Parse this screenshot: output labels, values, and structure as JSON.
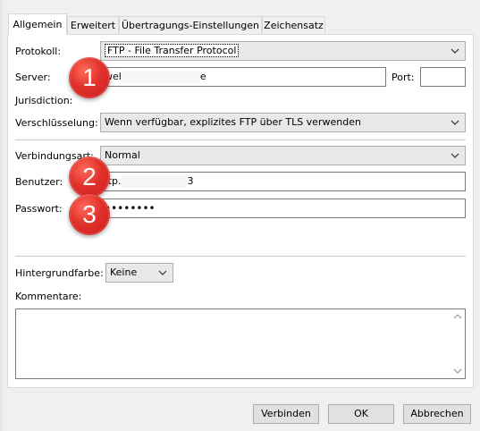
{
  "tabs": [
    {
      "label": "Allgemein",
      "active": true
    },
    {
      "label": "Erweitert",
      "active": false
    },
    {
      "label": "Übertragungs-Einstellungen",
      "active": false
    },
    {
      "label": "Zeichensatz",
      "active": false
    }
  ],
  "form": {
    "protokoll_label": "Protokoll:",
    "protokoll_value": "FTP - File Transfer Protocol",
    "server_label": "Server:",
    "server_value_start": "wel",
    "server_value_end": "e",
    "port_label": "Port:",
    "port_value": "",
    "jurisdiction_label": "Jurisdiction:",
    "verschluesselung_label": "Verschlüsselung:",
    "verschluesselung_value": "Wenn verfügbar, explizites FTP über TLS verwenden",
    "verbindungsart_label": "Verbindungsart:",
    "verbindungsart_value": "Normal",
    "benutzer_label": "Benutzer:",
    "benutzer_value_start": "ftp.",
    "benutzer_value_end": "3",
    "passwort_label": "Passwort:",
    "passwort_value": "••••••••",
    "hintergrundfarbe_label": "Hintergrundfarbe:",
    "hintergrundfarbe_value": "Keine",
    "kommentare_label": "Kommentare:",
    "kommentare_value": ""
  },
  "badges": [
    "1",
    "2",
    "3"
  ],
  "buttons": {
    "connect": "Verbinden",
    "ok": "OK",
    "cancel": "Abbrechen"
  },
  "colors": {
    "badge": "#e0302a",
    "panel": "#ffffff",
    "dialog": "#f0f0f0"
  },
  "icons": {
    "combo": "chevron-down-icon",
    "scroll_up": "scroll-up-arrow-icon",
    "scroll_down": "scroll-down-arrow-icon"
  }
}
